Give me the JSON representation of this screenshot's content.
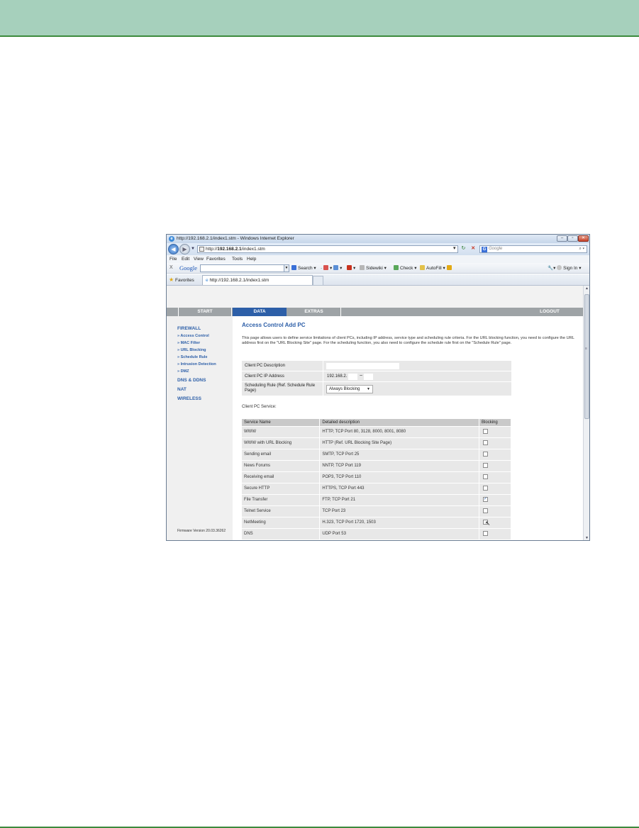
{
  "browser": {
    "title": "http://192.168.2.1/index1.stm - Windows Internet Explorer",
    "controls": {
      "minimize": "–",
      "maximize": "▫",
      "close": "✕"
    },
    "url_prefix": "http://",
    "url_host": "192.168.2.1",
    "url_path": "/index1.stm",
    "search_placeholder": "Google",
    "menu": [
      "File",
      "Edit",
      "View",
      "Favorites",
      "Tools",
      "Help"
    ],
    "google_toolbar": {
      "close": "X",
      "logo": "Google",
      "search_label": "Search",
      "sidewiki_label": "Sidewiki",
      "check_label": "Check",
      "autofill_label": "AutoFill",
      "signin_label": "Sign In"
    },
    "favorites_label": "Favorites",
    "tab_title": "http://192.168.2.1/index1.stm"
  },
  "router": {
    "nav": {
      "start": "START",
      "data": "DATA",
      "extras": "EXTRAS",
      "logout": "LOGOUT"
    },
    "sidebar": {
      "firewall": "FIREWALL",
      "items": [
        "» Access Control",
        "» MAC Filter",
        "» URL Blocking",
        "» Schedule Rule",
        "» Intrusion Detection",
        "» DMZ"
      ],
      "dns": "DNS & DDNS",
      "nat": "NAT",
      "wireless": "WIRELESS",
      "firmware": "Firmware Version 20.03.36262"
    },
    "page": {
      "title": "Access Control Add PC",
      "description": "This page allows users to define service limitations of client PCs, including IP address, service type and scheduling rule criteria. For the URL blocking function, you need to configure the URL address first on the \"URL Blocking Site\" page. For the scheduling function, you also need to configure the schedule rule first on the \"Schedule Rule\" page.",
      "form": {
        "desc_label": "Client PC Description",
        "desc_value": "",
        "ip_label": "Client PC IP Address",
        "ip_prefix": "192.168.2.",
        "ip_tilde": "~",
        "ip_start": "",
        "ip_end": "",
        "schedule_label": "Scheduling Rule (Ref. Schedule Rule Page)",
        "schedule_value": "Always Blocking"
      },
      "service_caption": "Client PC Service:",
      "service_headers": [
        "Service Name",
        "Detailed description",
        "Blocking"
      ],
      "services": [
        {
          "name": "WWW",
          "desc": "HTTP, TCP Port 80, 3128, 8000, 8001, 8080",
          "checked": ""
        },
        {
          "name": "WWW with URL Blocking",
          "desc": "HTTP (Ref. URL Blocking Site Page)",
          "checked": ""
        },
        {
          "name": "Sending email",
          "desc": "SMTP, TCP Port 25",
          "checked": ""
        },
        {
          "name": "News Forums",
          "desc": "NNTP, TCP Port 119",
          "checked": ""
        },
        {
          "name": "Receiving email",
          "desc": "POP3, TCP Port 110",
          "checked": ""
        },
        {
          "name": "Secure HTTP",
          "desc": "HTTPS, TCP Port 443",
          "checked": ""
        },
        {
          "name": "File Transfer",
          "desc": "FTP, TCP Port 21",
          "checked": "✓"
        },
        {
          "name": "Telnet Service",
          "desc": "TCP Port 23",
          "checked": ""
        },
        {
          "name": "NetMeeting",
          "desc": "H.323, TCP Port 1720, 1503",
          "checked": ""
        },
        {
          "name": "DNS",
          "desc": "UDP Port 53",
          "checked": ""
        }
      ]
    }
  },
  "colors": {
    "header_band": "#a6d0bc",
    "accent_line": "#3c8a3c",
    "router_blue": "#2d5fa8",
    "nav_gray": "#9ea3a6"
  }
}
